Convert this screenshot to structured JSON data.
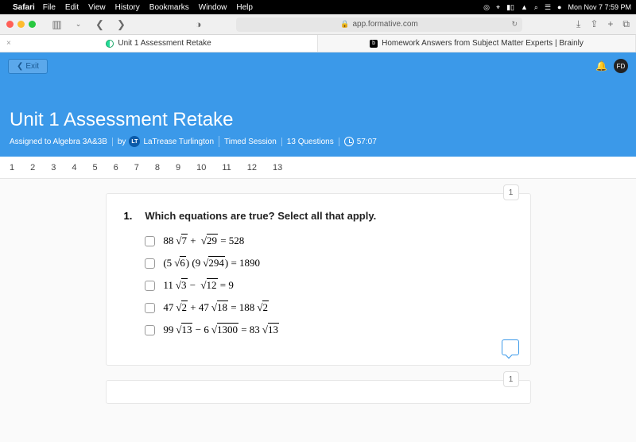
{
  "mac_menubar": {
    "app_name": "Safari",
    "menus": [
      "File",
      "Edit",
      "View",
      "History",
      "Bookmarks",
      "Window",
      "Help"
    ],
    "right_date": "Mon Nov 7  7:59 PM"
  },
  "safari": {
    "address": "app.formative.com",
    "tabs": {
      "a": {
        "label": "Unit 1 Assessment Retake"
      },
      "b": {
        "label": "Homework Answers from Subject Matter Experts | Brainly"
      }
    }
  },
  "page": {
    "exit_label": "Exit",
    "avatar_initials": "FD",
    "title": "Unit 1 Assessment Retake",
    "assigned_to": "Assigned to Algebra 3A&3B",
    "by_label": "by",
    "teacher_initials": "LT",
    "teacher_name": "LaTrease Turlington",
    "session_type": "Timed Session",
    "questions_label": "13 Questions",
    "timer": "57:07"
  },
  "qnav": [
    "1",
    "2",
    "3",
    "4",
    "5",
    "6",
    "7",
    "8",
    "9",
    "10",
    "11",
    "12",
    "13"
  ],
  "question": {
    "number": "1.",
    "points": "1",
    "text": "Which equations are true? Select all that apply.",
    "options": {
      "a": {
        "pre": "88",
        "r1": "7",
        "mid": " + ",
        "r2": "29",
        "post": " = 528"
      },
      "b": {
        "pre": "(5",
        "r1": "6",
        "mid": ") (9",
        "r2": "294",
        "post": ") = 1890"
      },
      "c": {
        "pre": "11",
        "r1": "3",
        "mid": " − ",
        "r2": "12",
        "post": " = 9"
      },
      "d": {
        "pre": "47",
        "r1": "2",
        "mid": " + 47",
        "r2": "18",
        "post_pre": " = 188",
        "r3": "2"
      },
      "e": {
        "pre": "99",
        "r1": "13",
        "mid": " − 6",
        "r2": "1300",
        "post_pre": " = 83",
        "r3": "13"
      }
    }
  },
  "card2_points": "1"
}
